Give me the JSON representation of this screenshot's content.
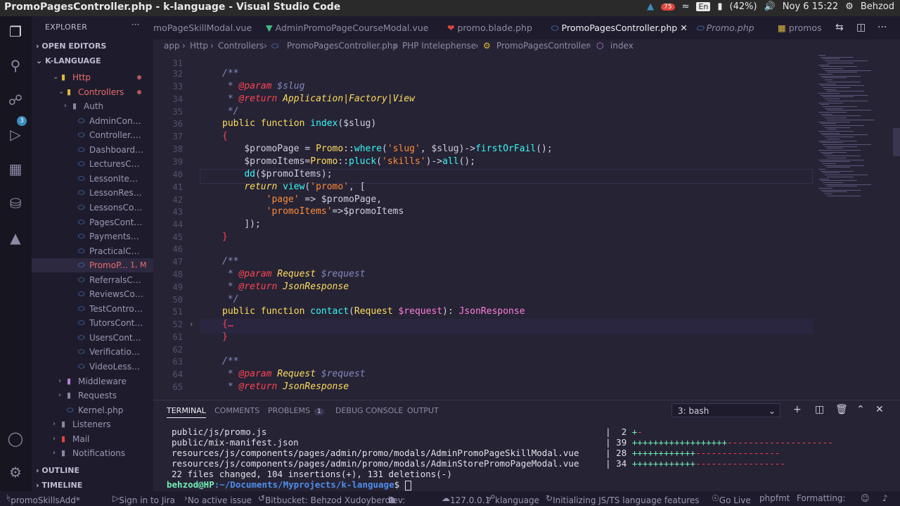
{
  "window": {
    "title": "PromoPagesController.php - k-language - Visual Studio Code",
    "battery": "(42%)",
    "datetime": "Noy 6 15:22",
    "user": "Behzod",
    "lang": "En",
    "notif_count": "75"
  },
  "sidebar": {
    "header": "EXPLORER",
    "open_editors": "OPEN EDITORS",
    "project": "K-LANGUAGE",
    "outline": "OUTLINE",
    "timeline": "TIMELINE",
    "tree": [
      {
        "label": "Http"
      },
      {
        "label": "Controllers"
      },
      {
        "label": "Auth"
      },
      {
        "label": "AdminControll..."
      },
      {
        "label": "Controller.php"
      },
      {
        "label": "DashboardCon..."
      },
      {
        "label": "LecturesContr..."
      },
      {
        "label": "LessonItemCon..."
      },
      {
        "label": "LessonResults..."
      },
      {
        "label": "LessonsControl..."
      },
      {
        "label": "PagesControlle..."
      },
      {
        "label": "PaymentsContr..."
      },
      {
        "label": "PracticalContr..."
      },
      {
        "label": "PromoP...",
        "status": "1, M"
      },
      {
        "label": "ReferralsContr..."
      },
      {
        "label": "ReviewsContro..."
      },
      {
        "label": "TestController...."
      },
      {
        "label": "TutorsControll..."
      },
      {
        "label": "UsersControlle..."
      },
      {
        "label": "VerificationCo..."
      },
      {
        "label": "VideoLessonCo..."
      },
      {
        "label": "Middleware"
      },
      {
        "label": "Requests"
      },
      {
        "label": "Kernel.php"
      },
      {
        "label": "Listeners"
      },
      {
        "label": "Mail"
      },
      {
        "label": "Notifications"
      }
    ]
  },
  "tabs": [
    {
      "label": "moPageSkillModal.vue"
    },
    {
      "label": "AdminPromoPageCourseModal.vue"
    },
    {
      "label": "promo.blade.php"
    },
    {
      "label": "PromoPagesController.php"
    },
    {
      "label": "Promo.php"
    },
    {
      "label": "promos"
    }
  ],
  "breadcrumb": [
    "app",
    "Http",
    "Controllers",
    "PromoPagesController.php",
    "PHP Intelephense",
    "PromoPagesController",
    "index"
  ],
  "editor": {
    "line_numbers": [
      "31",
      "32",
      "33",
      "34",
      "35",
      "36",
      "37",
      "38",
      "39",
      "40",
      "41",
      "42",
      "43",
      "44",
      "45",
      "46",
      "47",
      "48",
      "49",
      "50",
      "51",
      "52",
      "61",
      "62",
      "63",
      "64",
      "65"
    ],
    "t": {
      "cm_open": "/**",
      "cm_star": "*",
      "cm_close": "*/",
      "tag_param": "@param",
      "tag_return": "@return",
      "slug": "$slug",
      "app_type": "Application|Factory|View",
      "public": "public",
      "function": "function",
      "index": "index",
      "open_paren": "(",
      "slug_arg": "$slug",
      "close_paren": ")",
      "brace_open": "{",
      "brace_close": "}",
      "promoPage": "$promoPage",
      "eq": " = ",
      "Promo": "Promo",
      "dcolon": "::",
      "where": "where",
      "l38_args_a": "(",
      "l38_str": "'slug'",
      "l38_args_b": ", ",
      "l38_slug": "$slug",
      "l38_args_c": ")->",
      "firstOrFail": "firstOrFail",
      "l38_end": "();",
      "promoItems": "$promoItems",
      "eq2": "=",
      "pluck": "pluck",
      "l39_a": "(",
      "l39_str": "'skills'",
      "l39_b": ")->",
      "all": "all",
      "l39_end": "();",
      "dd": "dd",
      "dd_a": "(",
      "dd_var": "$promoItems",
      "dd_end": ");",
      "return": "return",
      "view": "view",
      "v_a": "(",
      "v_str": "'promo'",
      "v_b": ", [",
      "k_page": "'page'",
      "arrow": " => ",
      "arrow2": "=>",
      "v_page": "$promoPage",
      "comma": ",",
      "k_items": "'promoItems'",
      "v_items": "$promoItems",
      "arr_close": "]);",
      "Request": "Request",
      "request_var": "$request",
      "JsonResponse": "JsonResponse",
      "contact": "contact",
      "c_a": "(",
      "c_req": "Request",
      "c_sp": " ",
      "c_var": "$request",
      "c_b": "): ",
      "c_ret": "JsonResponse",
      "folded": "{…"
    }
  },
  "panel": {
    "tabs": [
      "TERMINAL",
      "COMMENTS",
      "PROBLEMS",
      "DEBUG CONSOLE",
      "OUTPUT"
    ],
    "problems_count": "1",
    "shell": "3: bash",
    "lines": [
      {
        "path": "public/js/promo.js",
        "count": "2",
        "plus": "+",
        "minus": "-"
      },
      {
        "path": "public/mix-manifest.json",
        "count": "39",
        "plus": "++++++++++++++++++",
        "minus": "--------------------"
      },
      {
        "path": "resources/js/components/pages/admin/promo/modals/AdminPromoPageSkillModal.vue",
        "count": "28",
        "plus": "++++++++++++",
        "minus": "----------------"
      },
      {
        "path": "resources/js/components/pages/admin/promo/modals/AdminStorePromoPageModal.vue",
        "count": "34",
        "plus": "++++++++++++",
        "minus": "-----------------"
      }
    ],
    "summary": "22 files changed, 104 insertions(+), 131 deletions(-)",
    "prompt_user": "behzod@HP",
    "prompt_path": ":~/Documents/Myprojects/k-language",
    "prompt_end": "$ "
  },
  "statusbar": {
    "branch": "promoSkillsAdd*",
    "jira": "Sign in to Jira",
    "issue": "No active issue",
    "bitbucket": "Bitbucket: Behzod Xudoyberdiev:",
    "errors": "1",
    "warnings": "0",
    "host": "127.0.0.1",
    "project": "klanguage",
    "init": "Initializing JS/TS language features",
    "golive": "Go Live",
    "phpfmt": "phpfmt",
    "formatting": "Formatting:"
  }
}
